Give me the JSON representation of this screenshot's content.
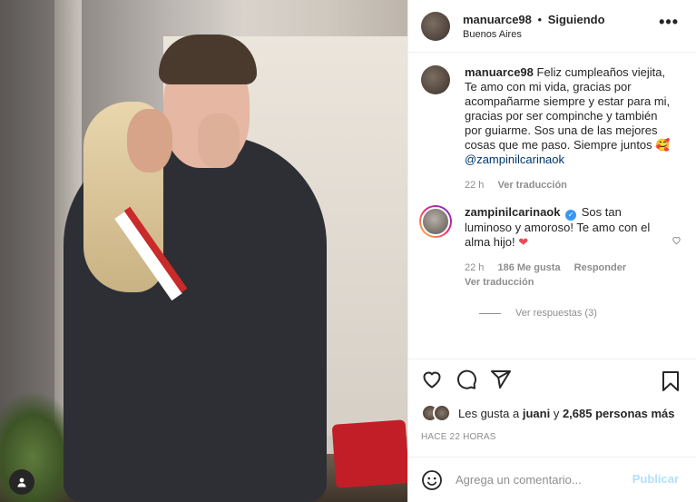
{
  "post": {
    "username": "manuarce98",
    "separator": "•",
    "follow_status": "Siguiendo",
    "location": "Buenos Aires",
    "more_label": "•••"
  },
  "caption": {
    "username": "manuarce98",
    "text": "Feliz cumpleaños viejita, Te amo con mi vida, gracias por acompañarme siempre y estar para mi, gracias por ser compinche y también por guiarme. Sos una de las mejores cosas que me paso. Siempre juntos 🥰",
    "mention": "@zampinilcarinaok",
    "time": "22 h",
    "translate": "Ver traducción"
  },
  "reply": {
    "username": "zampinilcarinaok",
    "verified_mark": "✓",
    "text": "Sos tan luminoso y amoroso! Te amo con el alma hijo!",
    "heart": "❤",
    "time": "22 h",
    "likes": "186 Me gusta",
    "reply_label": "Responder",
    "translate": "Ver traducción",
    "view_replies": "Ver respuestas (3)"
  },
  "likes": {
    "prefix": "Les gusta a",
    "user": "juani",
    "conj": "y",
    "others": "2,685 personas más"
  },
  "timestamp": "HACE 22 HORAS",
  "add_comment": {
    "placeholder": "Agrega un comentario...",
    "post_label": "Publicar"
  },
  "colors": {
    "text": "#262626",
    "secondary": "#8e8e8e",
    "link": "#00376b",
    "verified": "#3897f0",
    "publish_disabled": "#b2dffc",
    "like_red": "#ed4956"
  },
  "icons": [
    "person-tag-icon",
    "more-options-icon",
    "heart-icon",
    "comment-icon",
    "share-icon",
    "bookmark-icon",
    "emoji-icon",
    "verified-badge-icon"
  ]
}
